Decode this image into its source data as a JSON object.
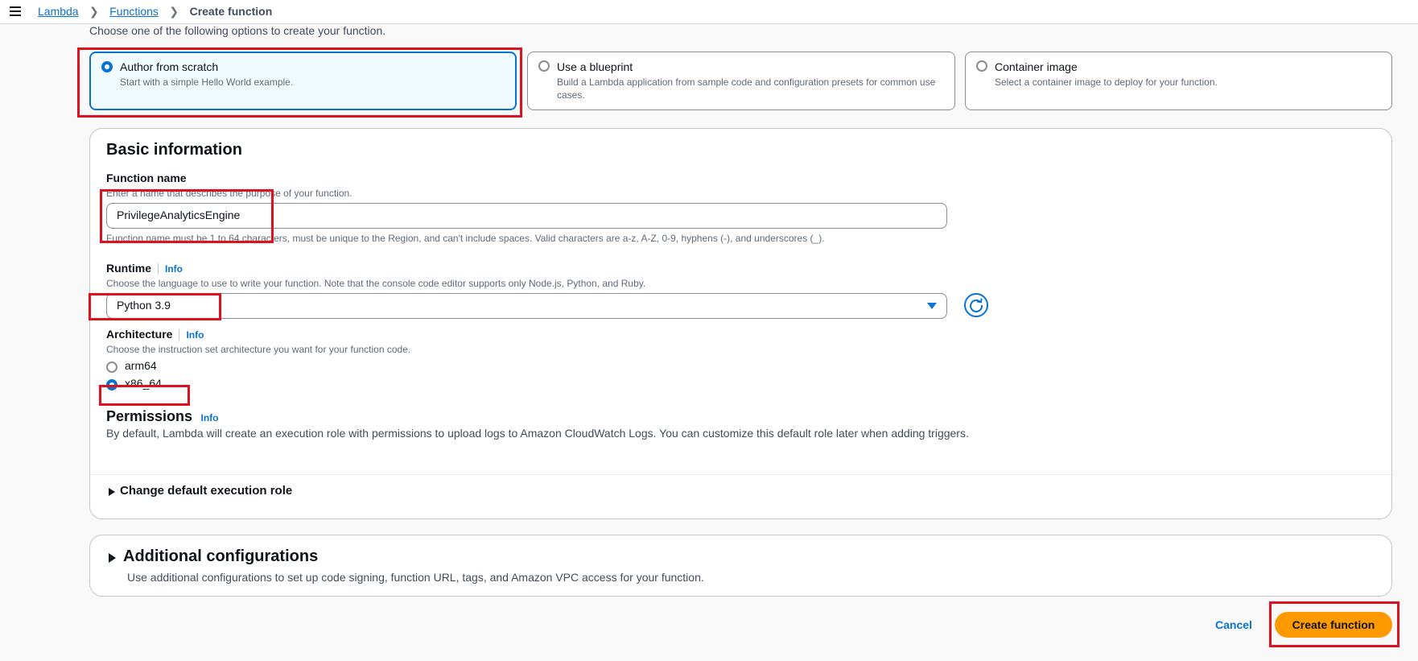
{
  "breadcrumb": {
    "items": [
      "Lambda",
      "Functions"
    ],
    "current": "Create function"
  },
  "intro_text": "Choose one of the following options to create your function.",
  "options": [
    {
      "title": "Author from scratch",
      "description": "Start with a simple Hello World example.",
      "selected": true
    },
    {
      "title": "Use a blueprint",
      "description": "Build a Lambda application from sample code and configuration presets for common use cases.",
      "selected": false
    },
    {
      "title": "Container image",
      "description": "Select a container image to deploy for your function.",
      "selected": false
    }
  ],
  "basic_info": {
    "heading": "Basic information",
    "function_name": {
      "label": "Function name",
      "description": "Enter a name that describes the purpose of your function.",
      "value": "PrivilegeAnalyticsEngine",
      "constraint": "Function name must be 1 to 64 characters, must be unique to the Region, and can't include spaces. Valid characters are a-z, A-Z, 0-9, hyphens (-), and underscores (_)."
    },
    "runtime": {
      "label": "Runtime",
      "info": "Info",
      "description": "Choose the language to use to write your function. Note that the console code editor supports only Node.js, Python, and Ruby.",
      "value": "Python 3.9"
    },
    "architecture": {
      "label": "Architecture",
      "info": "Info",
      "description": "Choose the instruction set architecture you want for your function code.",
      "options": [
        "arm64",
        "x86_64"
      ],
      "selected": "x86_64"
    },
    "permissions": {
      "label": "Permissions",
      "info": "Info",
      "description": "By default, Lambda will create an execution role with permissions to upload logs to Amazon CloudWatch Logs. You can customize this default role later when adding triggers."
    },
    "change_role": "Change default execution role"
  },
  "additional": {
    "heading": "Additional configurations",
    "description": "Use additional configurations to set up code signing, function URL, tags, and Amazon VPC access for your function."
  },
  "actions": {
    "cancel": "Cancel",
    "create": "Create function"
  },
  "colors": {
    "accent": "#0972d3",
    "primary_button": "#ff9900",
    "highlight": "#e0111f"
  }
}
